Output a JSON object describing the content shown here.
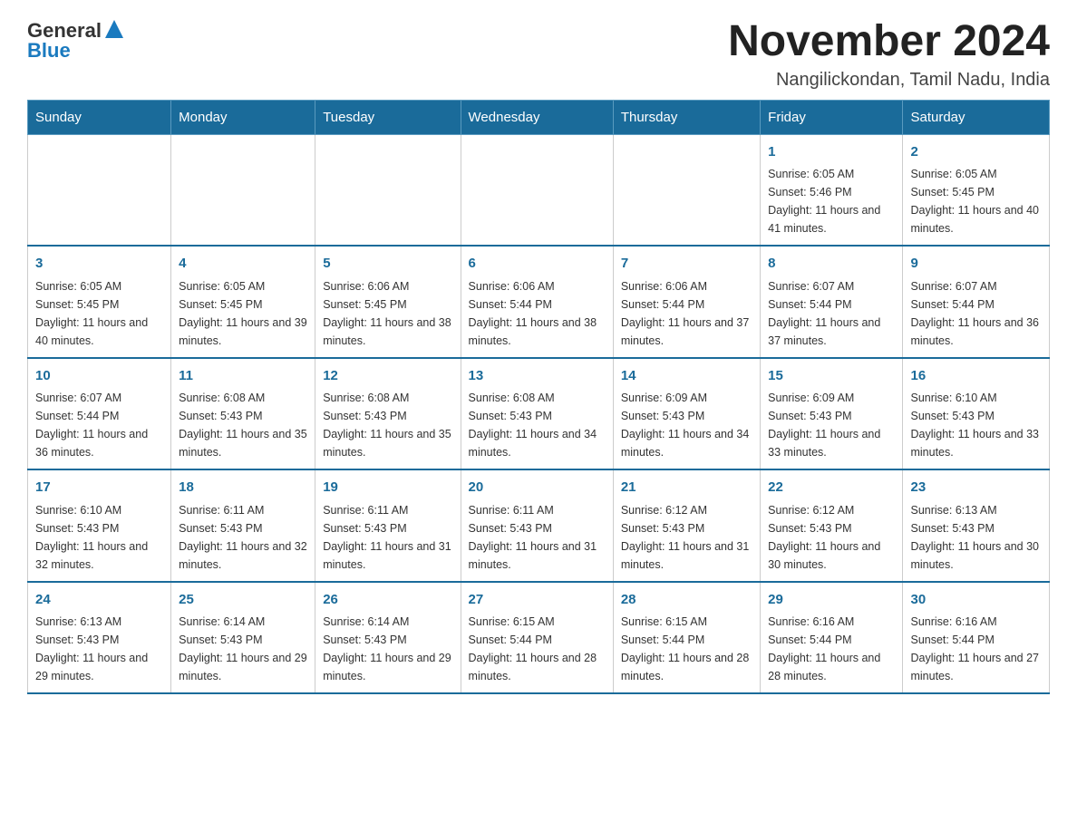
{
  "logo": {
    "text_general": "General",
    "text_blue": "Blue"
  },
  "header": {
    "month_year": "November 2024",
    "location": "Nangilickondan, Tamil Nadu, India"
  },
  "weekdays": [
    "Sunday",
    "Monday",
    "Tuesday",
    "Wednesday",
    "Thursday",
    "Friday",
    "Saturday"
  ],
  "weeks": [
    [
      {
        "day": "",
        "info": ""
      },
      {
        "day": "",
        "info": ""
      },
      {
        "day": "",
        "info": ""
      },
      {
        "day": "",
        "info": ""
      },
      {
        "day": "",
        "info": ""
      },
      {
        "day": "1",
        "info": "Sunrise: 6:05 AM\nSunset: 5:46 PM\nDaylight: 11 hours and 41 minutes."
      },
      {
        "day": "2",
        "info": "Sunrise: 6:05 AM\nSunset: 5:45 PM\nDaylight: 11 hours and 40 minutes."
      }
    ],
    [
      {
        "day": "3",
        "info": "Sunrise: 6:05 AM\nSunset: 5:45 PM\nDaylight: 11 hours and 40 minutes."
      },
      {
        "day": "4",
        "info": "Sunrise: 6:05 AM\nSunset: 5:45 PM\nDaylight: 11 hours and 39 minutes."
      },
      {
        "day": "5",
        "info": "Sunrise: 6:06 AM\nSunset: 5:45 PM\nDaylight: 11 hours and 38 minutes."
      },
      {
        "day": "6",
        "info": "Sunrise: 6:06 AM\nSunset: 5:44 PM\nDaylight: 11 hours and 38 minutes."
      },
      {
        "day": "7",
        "info": "Sunrise: 6:06 AM\nSunset: 5:44 PM\nDaylight: 11 hours and 37 minutes."
      },
      {
        "day": "8",
        "info": "Sunrise: 6:07 AM\nSunset: 5:44 PM\nDaylight: 11 hours and 37 minutes."
      },
      {
        "day": "9",
        "info": "Sunrise: 6:07 AM\nSunset: 5:44 PM\nDaylight: 11 hours and 36 minutes."
      }
    ],
    [
      {
        "day": "10",
        "info": "Sunrise: 6:07 AM\nSunset: 5:44 PM\nDaylight: 11 hours and 36 minutes."
      },
      {
        "day": "11",
        "info": "Sunrise: 6:08 AM\nSunset: 5:43 PM\nDaylight: 11 hours and 35 minutes."
      },
      {
        "day": "12",
        "info": "Sunrise: 6:08 AM\nSunset: 5:43 PM\nDaylight: 11 hours and 35 minutes."
      },
      {
        "day": "13",
        "info": "Sunrise: 6:08 AM\nSunset: 5:43 PM\nDaylight: 11 hours and 34 minutes."
      },
      {
        "day": "14",
        "info": "Sunrise: 6:09 AM\nSunset: 5:43 PM\nDaylight: 11 hours and 34 minutes."
      },
      {
        "day": "15",
        "info": "Sunrise: 6:09 AM\nSunset: 5:43 PM\nDaylight: 11 hours and 33 minutes."
      },
      {
        "day": "16",
        "info": "Sunrise: 6:10 AM\nSunset: 5:43 PM\nDaylight: 11 hours and 33 minutes."
      }
    ],
    [
      {
        "day": "17",
        "info": "Sunrise: 6:10 AM\nSunset: 5:43 PM\nDaylight: 11 hours and 32 minutes."
      },
      {
        "day": "18",
        "info": "Sunrise: 6:11 AM\nSunset: 5:43 PM\nDaylight: 11 hours and 32 minutes."
      },
      {
        "day": "19",
        "info": "Sunrise: 6:11 AM\nSunset: 5:43 PM\nDaylight: 11 hours and 31 minutes."
      },
      {
        "day": "20",
        "info": "Sunrise: 6:11 AM\nSunset: 5:43 PM\nDaylight: 11 hours and 31 minutes."
      },
      {
        "day": "21",
        "info": "Sunrise: 6:12 AM\nSunset: 5:43 PM\nDaylight: 11 hours and 31 minutes."
      },
      {
        "day": "22",
        "info": "Sunrise: 6:12 AM\nSunset: 5:43 PM\nDaylight: 11 hours and 30 minutes."
      },
      {
        "day": "23",
        "info": "Sunrise: 6:13 AM\nSunset: 5:43 PM\nDaylight: 11 hours and 30 minutes."
      }
    ],
    [
      {
        "day": "24",
        "info": "Sunrise: 6:13 AM\nSunset: 5:43 PM\nDaylight: 11 hours and 29 minutes."
      },
      {
        "day": "25",
        "info": "Sunrise: 6:14 AM\nSunset: 5:43 PM\nDaylight: 11 hours and 29 minutes."
      },
      {
        "day": "26",
        "info": "Sunrise: 6:14 AM\nSunset: 5:43 PM\nDaylight: 11 hours and 29 minutes."
      },
      {
        "day": "27",
        "info": "Sunrise: 6:15 AM\nSunset: 5:44 PM\nDaylight: 11 hours and 28 minutes."
      },
      {
        "day": "28",
        "info": "Sunrise: 6:15 AM\nSunset: 5:44 PM\nDaylight: 11 hours and 28 minutes."
      },
      {
        "day": "29",
        "info": "Sunrise: 6:16 AM\nSunset: 5:44 PM\nDaylight: 11 hours and 28 minutes."
      },
      {
        "day": "30",
        "info": "Sunrise: 6:16 AM\nSunset: 5:44 PM\nDaylight: 11 hours and 27 minutes."
      }
    ]
  ]
}
